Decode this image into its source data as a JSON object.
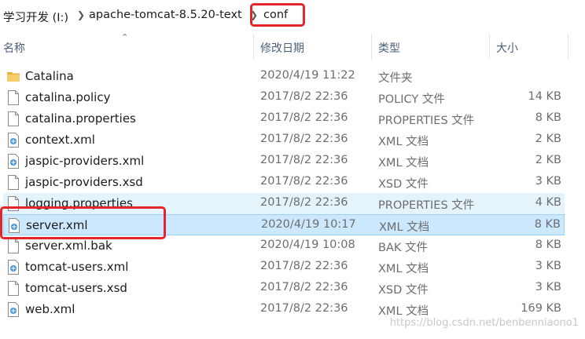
{
  "breadcrumb": {
    "drive": "学习开发 (I:)",
    "folder": "apache-tomcat-8.5.20-text",
    "current": "conf"
  },
  "header": {
    "name": "名称",
    "modified": "修改日期",
    "type": "类型",
    "size": "大小"
  },
  "files": [
    {
      "name": "Catalina",
      "modified": "2020/4/19 11:22",
      "type": "文件夹",
      "size": "",
      "icon": "folder-icon"
    },
    {
      "name": "catalina.policy",
      "modified": "2017/8/2 22:36",
      "type": "POLICY 文件",
      "size": "14 KB",
      "icon": "file-icon"
    },
    {
      "name": "catalina.properties",
      "modified": "2017/8/2 22:36",
      "type": "PROPERTIES 文件",
      "size": "8 KB",
      "icon": "file-icon"
    },
    {
      "name": "context.xml",
      "modified": "2017/8/2 22:36",
      "type": "XML 文档",
      "size": "2 KB",
      "icon": "xml-file-icon"
    },
    {
      "name": "jaspic-providers.xml",
      "modified": "2017/8/2 22:36",
      "type": "XML 文档",
      "size": "2 KB",
      "icon": "xml-file-icon"
    },
    {
      "name": "jaspic-providers.xsd",
      "modified": "2017/8/2 22:36",
      "type": "XSD 文件",
      "size": "3 KB",
      "icon": "file-icon"
    },
    {
      "name": "logging.properties",
      "modified": "2017/8/2 22:36",
      "type": "PROPERTIES 文件",
      "size": "4 KB",
      "icon": "file-icon"
    },
    {
      "name": "server.xml",
      "modified": "2020/4/19 10:17",
      "type": "XML 文档",
      "size": "8 KB",
      "icon": "xml-file-icon"
    },
    {
      "name": "server.xml.bak",
      "modified": "2020/4/19 10:08",
      "type": "BAK 文件",
      "size": "8 KB",
      "icon": "file-icon"
    },
    {
      "name": "tomcat-users.xml",
      "modified": "2017/8/2 22:36",
      "type": "XML 文档",
      "size": "3 KB",
      "icon": "xml-file-icon"
    },
    {
      "name": "tomcat-users.xsd",
      "modified": "2017/8/2 22:36",
      "type": "XSD 文件",
      "size": "3 KB",
      "icon": "file-icon"
    },
    {
      "name": "web.xml",
      "modified": "2017/8/2 22:36",
      "type": "XML 文档",
      "size": "169 KB",
      "icon": "xml-file-icon"
    }
  ],
  "watermark": "https://blog.csdn.net/benbenniaono1",
  "colors": {
    "annotation": "#e3262c",
    "selected_row": "#cce8ff",
    "hover_row": "#e5f3fb",
    "folder": "#f2c55c"
  }
}
